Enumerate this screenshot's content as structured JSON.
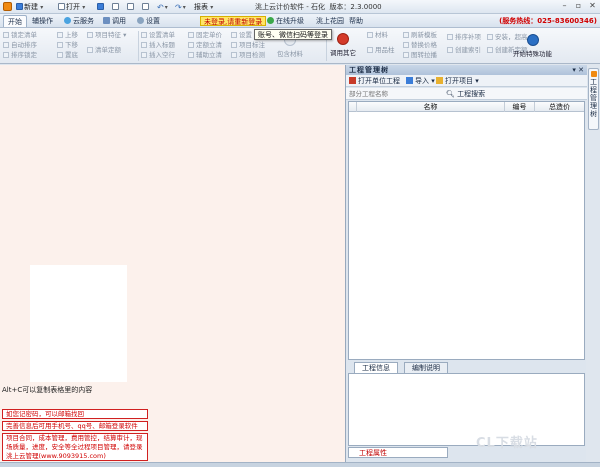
{
  "window": {
    "title": "洮上云计价软件 - 石化",
    "version_label": "版本：2.3.0000"
  },
  "quick_access": {
    "new": "新建",
    "open": "打开",
    "report": "报表"
  },
  "tabs": [
    "开始",
    "辅操作",
    "云服务",
    "调用",
    "设置"
  ],
  "login_notice": "未登录,请重新登录",
  "menu_right": [
    "在线升级",
    "洮上花园",
    "帮助"
  ],
  "hotline": "(服务热线：025-83600346)",
  "tooltip": "账号、微信扫码等登录",
  "ribbon": {
    "col1": [
      "锁定清单",
      "自动排序",
      "排序锁定"
    ],
    "col2": [
      "上移",
      "下移",
      "置底"
    ],
    "col3": [
      "项目特征",
      "清单定额"
    ],
    "col4": [
      "设置清单",
      "插入标题",
      "插入空行"
    ],
    "col5": [
      "固定单价",
      "定额立清",
      "辅助立清"
    ],
    "col6": [
      "设置",
      "项目标注",
      "项目检测"
    ],
    "col7_big": "包含材料",
    "call_other": "调用其它",
    "col8": [
      "材料",
      "用品柱"
    ],
    "col9": [
      "刷新模板",
      "替换价格",
      "图转拉播"
    ],
    "col10": [
      "排序补项",
      "创建索引"
    ],
    "col11": [
      "安装，超高",
      "创建新定额"
    ],
    "start_special": "开始特殊功能"
  },
  "left": {
    "hint": "Alt+C可以复制表格里的内容",
    "notes": [
      "如您记密码，可以邮箱找回",
      "完善信息后可用手机号、qq号、邮箱登录软件",
      "项目合同，成本管理，费用管控，结算审计，现场质量，进度，安全等全过程项目管理，请登录洮上云管理(www.9093915.com)"
    ]
  },
  "project_panel": {
    "title": "工程管理树",
    "pin": "▾ ✕",
    "tools": [
      "打开单位工程",
      "导入",
      "打开项目"
    ],
    "search_placeholder": "部分工程名称",
    "search_button": "工程搜索",
    "columns": [
      "",
      "名称",
      "编号",
      "总造价"
    ],
    "info_tabs": [
      "工程信息",
      "编制说明"
    ],
    "props_tab": "工程属性",
    "watermark": "CL下载站"
  },
  "side_tab": "工程管理树",
  "colors": {
    "accent": "#f08a12",
    "notice_bg": "#ffe566",
    "red": "#d00000"
  }
}
